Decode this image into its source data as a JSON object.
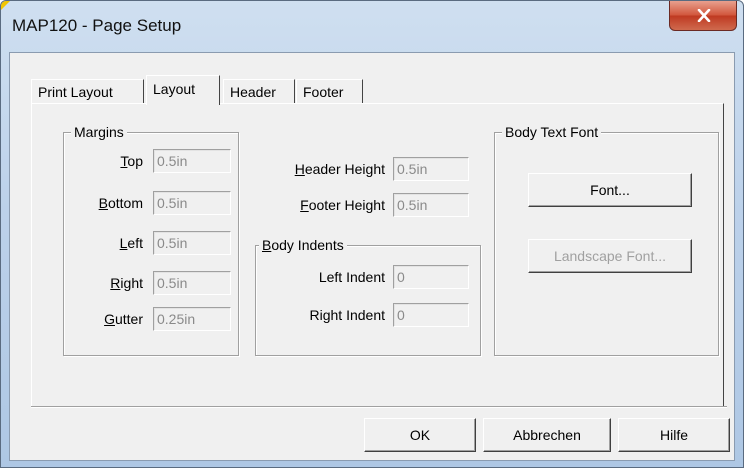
{
  "window": {
    "title": "MAP120 - Page Setup"
  },
  "tabs": [
    {
      "label": "Print Layout"
    },
    {
      "label": "Layout"
    },
    {
      "label": "Header"
    },
    {
      "label": "Footer"
    }
  ],
  "active_tab": "Layout",
  "margins": {
    "title": "Margins",
    "fields": [
      {
        "label": "Top",
        "mnemonic": "T",
        "value": "0.5in"
      },
      {
        "label": "Bottom",
        "mnemonic": "B",
        "value": "0.5in"
      },
      {
        "label": "Left",
        "mnemonic": "L",
        "value": "0.5in"
      },
      {
        "label": "Right",
        "mnemonic": "R",
        "value": "0.5in"
      },
      {
        "label": "Gutter",
        "mnemonic": "G",
        "value": "0.25in"
      }
    ]
  },
  "header_footer": {
    "header_height": {
      "label": "Header Height",
      "mnemonic": "H",
      "value": "0.5in"
    },
    "footer_height": {
      "label": "Footer Height",
      "mnemonic": "F",
      "value": "0.5in"
    }
  },
  "body_indents": {
    "title": "Body Indents",
    "title_mnemonic": "B",
    "left_indent": {
      "label": "Left Indent",
      "value": "0"
    },
    "right_indent": {
      "label": "Right Indent",
      "value": "0"
    }
  },
  "body_text_font": {
    "title": "Body Text Font",
    "font_button": "Font...",
    "landscape_font_button": "Landscape Font..."
  },
  "buttons": {
    "ok": "OK",
    "cancel": "Abbrechen",
    "help": "Hilfe"
  },
  "colors": {
    "title_bar": "#bcd1ea",
    "close_button": "#c9452c",
    "dialog_face": "#f0f0f0",
    "disabled_text": "#a0a0a0"
  },
  "icons": {
    "close": "close-icon"
  }
}
